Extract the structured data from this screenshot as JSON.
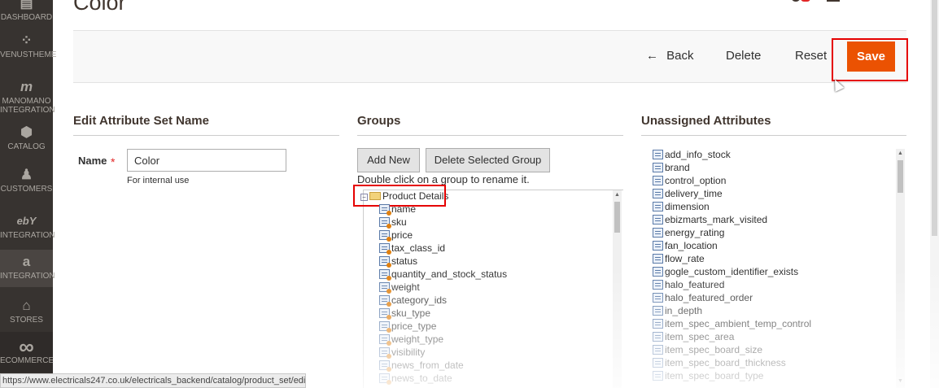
{
  "sidebar": {
    "items": [
      {
        "label": "DASHBOARD",
        "icon": "dashboard-icon",
        "glyph": "▤"
      },
      {
        "label": "VENUSTHEME",
        "icon": "venustheme-icon",
        "glyph": "⁘"
      },
      {
        "label": "MANOMANO INTEGRATION",
        "icon": "manomano-icon",
        "glyph": "m"
      },
      {
        "label": "CATALOG",
        "icon": "catalog-icon",
        "glyph": "⬢"
      },
      {
        "label": "CUSTOMERS",
        "icon": "customers-icon",
        "glyph": "♟"
      },
      {
        "label": "INTEGRATION",
        "icon": "ebay-icon",
        "glyph": "ebY"
      },
      {
        "label": "INTEGRATION",
        "icon": "amazon-icon",
        "glyph": "a"
      },
      {
        "label": "STORES",
        "icon": "stores-icon",
        "glyph": "⌂"
      },
      {
        "label": "ECOMMERCE",
        "icon": "infinity-icon",
        "glyph": "∞"
      }
    ]
  },
  "page": {
    "title": "Color"
  },
  "toolbar": {
    "back": "Back",
    "back_glyph": "←",
    "delete": "Delete",
    "reset": "Reset",
    "save": "Save"
  },
  "left_panel": {
    "title": "Edit Attribute Set Name",
    "name_label": "Name",
    "required": "*",
    "name_value": "Color",
    "hint": "For internal use"
  },
  "groups": {
    "title": "Groups",
    "add_new": "Add New",
    "delete_selected": "Delete Selected Group",
    "hint": "Double click on a group to rename it.",
    "root": "Product Details",
    "items": [
      "name",
      "sku",
      "price",
      "tax_class_id",
      "status",
      "quantity_and_stock_status",
      "weight",
      "category_ids",
      "sku_type",
      "price_type",
      "weight_type",
      "visibility",
      "news_from_date",
      "news_to_date"
    ]
  },
  "unassigned": {
    "title": "Unassigned Attributes",
    "items": [
      "add_info_stock",
      "brand",
      "control_option",
      "delivery_time",
      "dimension",
      "ebizmarts_mark_visited",
      "energy_rating",
      "fan_location",
      "flow_rate",
      "gogle_custom_identifier_exists",
      "halo_featured",
      "halo_featured_order",
      "in_depth",
      "item_spec_ambient_temp_control",
      "item_spec_area",
      "item_spec_board_size",
      "item_spec_board_thickness",
      "item_spec_board_type"
    ]
  },
  "status_bar": {
    "url": "https://www.electricals247.co.uk/electricals_backend/catalog/product_set/edit/id/..."
  },
  "colors": {
    "accent": "#eb5202",
    "sidebar": "#373330",
    "highlight": "#e50000"
  }
}
